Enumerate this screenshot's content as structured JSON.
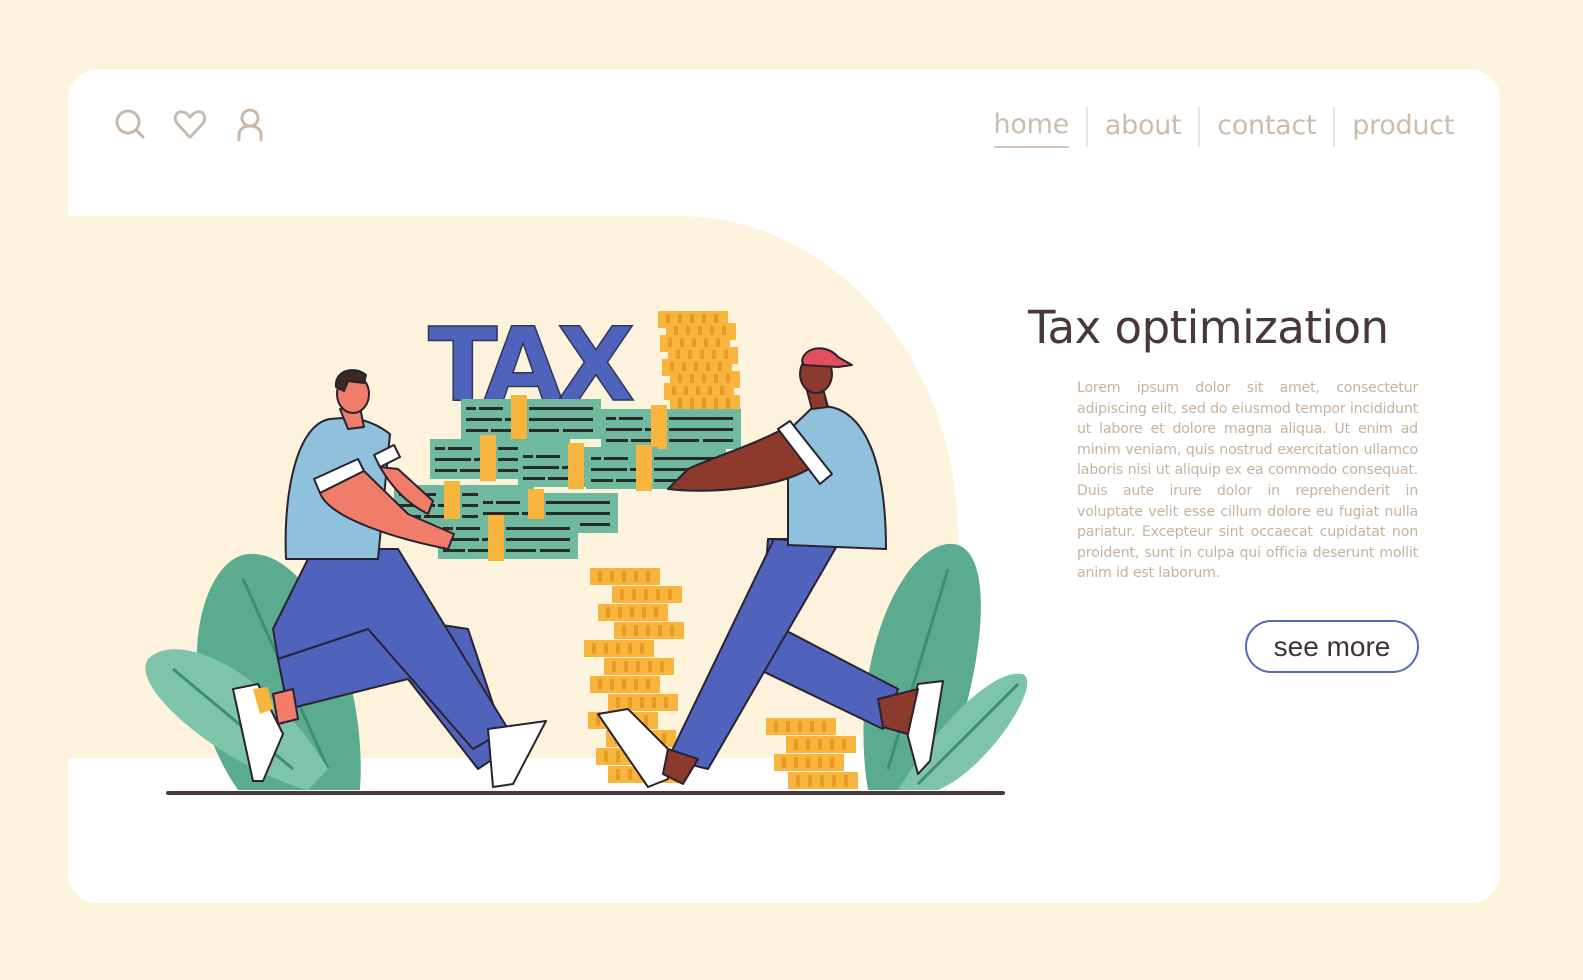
{
  "header": {
    "icons": [
      {
        "name": "search-icon",
        "label": "search"
      },
      {
        "name": "heart-icon",
        "label": "favorites"
      },
      {
        "name": "user-icon",
        "label": "account"
      }
    ],
    "nav": [
      {
        "label": "home",
        "active": true
      },
      {
        "label": "about",
        "active": false
      },
      {
        "label": "contact",
        "active": false
      },
      {
        "label": "product",
        "active": false
      }
    ]
  },
  "hero": {
    "title": "Tax optimization",
    "description": "Lorem ipsum dolor sit amet, consectetur adipiscing elit, sed do eiusmod tempor incididunt ut labore et dolore magna aliqua. Ut enim ad minim veniam, quis nostrud exercitation ullamco laboris nisi ut aliquip ex ea commodo consequat. Duis aute irure dolor in reprehenderit in voluptate velit esse cillum dolore eu fugiat nulla pariatur. Excepteur sint occaecat cupidatat non proident, sunt in culpa qui officia deserunt mollit anim id est laborum.",
    "cta_label": "see more"
  },
  "illustration": {
    "sign_text": "TAX",
    "description": "Two men carrying stacks of banknotes beneath the word TAX, with stacks of gold coins and green leaves"
  },
  "colors": {
    "page_bg": "#fdf3dc",
    "card_bg": "#ffffff",
    "accent_blue": "#4f63bd",
    "title_text": "#4a3838",
    "muted_text": "#c7b29e",
    "nav_text": "#cbbcae",
    "cta_border": "#5469b7",
    "cash_green": "#6fb99f",
    "coin_gold": "#f7b53e",
    "leaf_green": "#5aab8f"
  }
}
